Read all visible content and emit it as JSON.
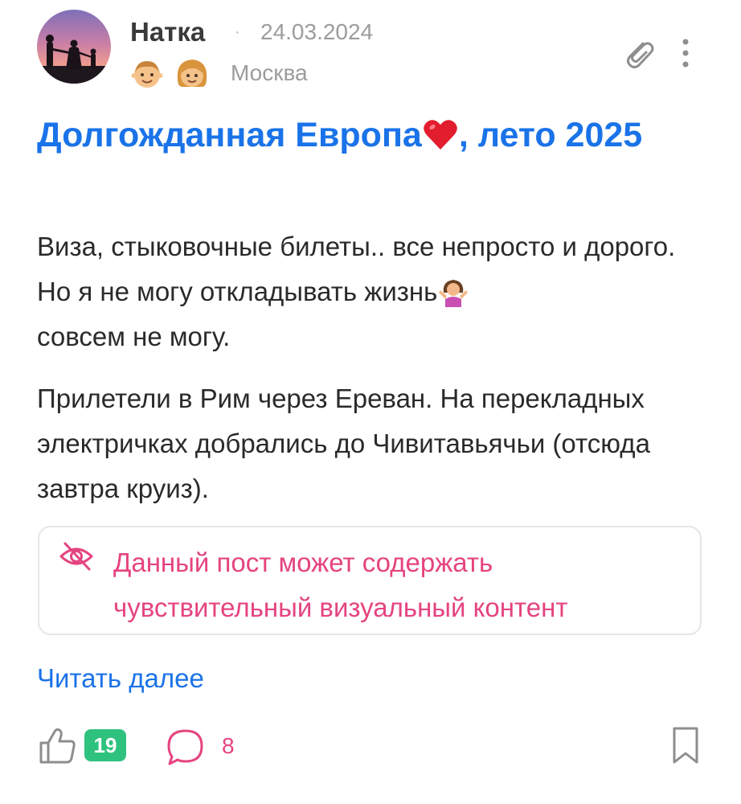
{
  "author": {
    "name": "Натка",
    "separator": "·",
    "date": "24.03.2024",
    "location": "Москва",
    "kids_icons": [
      "boy-kid-icon",
      "girl-kid-icon"
    ]
  },
  "post": {
    "title_part1": "Долгожданная Европа",
    "title_emoji": "heart-emoji",
    "title_part2": ", лето 2025",
    "paragraph1_part1": "Виза, стыковочные билеты.. все непросто и дорого. Но я не могу откладывать жизнь",
    "paragraph1_emoji": "person-shrugging-emoji",
    "paragraph1_part2": "совсем не могу.",
    "paragraph2": "Прилетели в Рим через Ереван. На перекладных электричках добрались до Чивитавьячьи (отсюда завтра круиз).",
    "sensitive_warning": "Данный пост может содержать чувствительный визуальный контент",
    "read_more": "Читать далее"
  },
  "actions": {
    "likes": "19",
    "comments": "8"
  },
  "colors": {
    "title_blue": "#1a73e8",
    "warning_pink": "#e5447f",
    "like_badge_green": "#2ec27e",
    "meta_gray": "#9c9c9c"
  }
}
